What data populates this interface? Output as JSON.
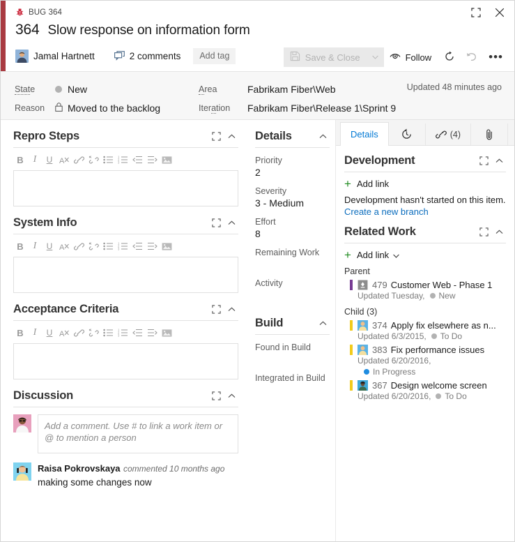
{
  "window": {
    "type_label": "BUG 364",
    "type_icon": "bug-icon",
    "restore_icon": "restore-icon",
    "close_icon": "close-icon"
  },
  "header": {
    "work_item_id": "364",
    "title": "Slow response on information form",
    "assignee": "Jamal Hartnett",
    "comments_label": "2 comments",
    "add_tag_label": "Add tag"
  },
  "commands": {
    "save_close_label": "Save & Close",
    "save_close_enabled": false,
    "save_icon": "save-icon",
    "caret_icon": "chevron-down-icon",
    "follow_label": "Follow",
    "follow_icon": "eye-icon",
    "refresh_icon": "refresh-icon",
    "revert_icon": "undo-icon",
    "more_icon": "ellipsis-icon"
  },
  "fields_strip": {
    "state_label": "State",
    "state_value": "New",
    "reason_label": "Reason",
    "reason_value": "Moved to the backlog",
    "reason_icon": "lock-icon",
    "area_label": "Area",
    "area_value": "Fabrikam Fiber\\Web",
    "iteration_label": "Iteration",
    "iteration_value": "Fabrikam Fiber\\Release 1\\Sprint 9",
    "updated_text": "Updated 48 minutes ago",
    "state_dot_color": "#b2b2b2"
  },
  "editor_toolbar": {
    "buttons": [
      {
        "name": "bold-icon",
        "glyph": "B"
      },
      {
        "name": "italic-icon",
        "glyph": "I"
      },
      {
        "name": "underline-icon",
        "glyph": "U"
      },
      {
        "name": "clear-format-icon",
        "glyph": "A"
      },
      {
        "name": "link-icon",
        "glyph": "link"
      },
      {
        "name": "unlink-icon",
        "glyph": "unlink"
      },
      {
        "name": "bullet-list-icon",
        "glyph": "bullets"
      },
      {
        "name": "numbered-list-icon",
        "glyph": "numbers"
      },
      {
        "name": "outdent-icon",
        "glyph": "outdent"
      },
      {
        "name": "indent-icon",
        "glyph": "indent"
      },
      {
        "name": "insert-image-icon",
        "glyph": "image"
      }
    ]
  },
  "left_sections": {
    "repro_steps": {
      "title": "Repro Steps",
      "value": ""
    },
    "system_info": {
      "title": "System Info",
      "value": ""
    },
    "acceptance_criteria": {
      "title": "Acceptance Criteria",
      "value": ""
    },
    "discussion": {
      "title": "Discussion",
      "placeholder": "Add a comment. Use # to link a work item or @ to mention a person",
      "comments": [
        {
          "author": "Raisa Pokrovskaya",
          "meta": "commented 10 months ago",
          "text": "making some changes now"
        }
      ]
    }
  },
  "details_panel": {
    "title": "Details",
    "fields": [
      {
        "label": "Priority",
        "value": "2"
      },
      {
        "label": "Severity",
        "value": "3 - Medium"
      },
      {
        "label": "Effort",
        "value": "8"
      },
      {
        "label": "Remaining Work",
        "value": ""
      },
      {
        "label": "Activity",
        "value": ""
      }
    ]
  },
  "build_panel": {
    "title": "Build",
    "fields": [
      {
        "label": "Found in Build",
        "value": ""
      },
      {
        "label": "Integrated in Build",
        "value": ""
      }
    ]
  },
  "tabs": [
    {
      "label": "Details",
      "name": "tab-details",
      "icon": "",
      "count": "",
      "active": true
    },
    {
      "label": "",
      "name": "tab-history",
      "icon": "history-icon",
      "count": "",
      "active": false
    },
    {
      "label": "",
      "name": "tab-links",
      "icon": "link-icon",
      "count": "(4)",
      "active": false
    },
    {
      "label": "",
      "name": "tab-attachments",
      "icon": "paperclip-icon",
      "count": "",
      "active": false
    }
  ],
  "development": {
    "title": "Development",
    "add_link_label": "Add link",
    "empty_text": "Development hasn't started on this item.",
    "create_branch_label": "Create a new branch",
    "link_color": "#0a6cbd"
  },
  "related_work": {
    "title": "Related Work",
    "add_link_label": "Add link",
    "groups": [
      {
        "label": "Parent",
        "items": [
          {
            "id": "479",
            "title": "Customer Web - Phase 1",
            "updated": "Updated Tuesday,",
            "state": "New",
            "state_dot": "#b2b2b2",
            "bar_color": "#773b93",
            "type_icon": "feature-icon",
            "wraps": false
          }
        ]
      },
      {
        "label": "Child (3)",
        "items": [
          {
            "id": "374",
            "title": "Apply fix elsewhere as n...",
            "updated": "Updated 6/3/2015,",
            "state": "To Do",
            "state_dot": "#b2b2b2",
            "bar_color": "#f2cb1d",
            "type_icon": "task-icon",
            "wraps": false
          },
          {
            "id": "383",
            "title": "Fix performance issues",
            "updated": "Updated 6/20/2016,",
            "state": "In Progress",
            "state_dot": "#1f8ce0",
            "bar_color": "#f2cb1d",
            "type_icon": "task-icon",
            "wraps": true
          },
          {
            "id": "367",
            "title": "Design welcome screen",
            "updated": "Updated 6/20/2016,",
            "state": "To Do",
            "state_dot": "#b2b2b2",
            "bar_color": "#f2cb1d",
            "type_icon": "task-icon",
            "wraps": false
          }
        ]
      }
    ]
  }
}
